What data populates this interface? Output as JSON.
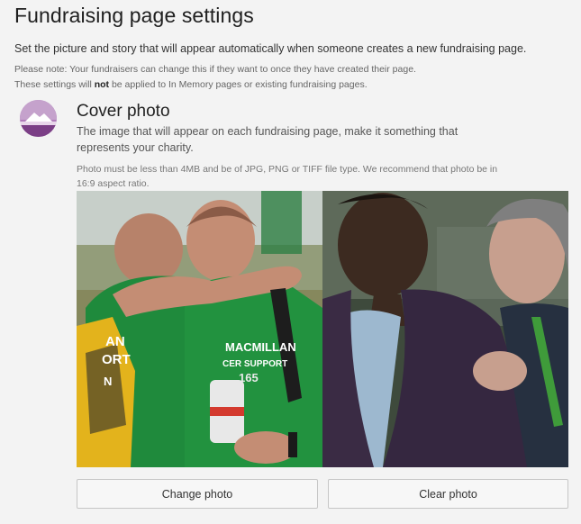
{
  "page": {
    "title": "Fundraising page settings",
    "intro": "Set the picture and story that will appear automatically when someone creates a new fundraising page.",
    "note_line1": "Please note: Your fundraisers can change this if they want to once they have created their page.",
    "note_line2_prefix": "These settings will ",
    "note_line2_bold": "not",
    "note_line2_suffix": " be applied to In Memory pages or existing fundraising pages."
  },
  "cover_photo": {
    "icon": "photo-landscape-icon",
    "title": "Cover photo",
    "description": "The image that will appear on each fundraising page, make it something that represents your charity.",
    "requirements": "Photo must be less than 4MB and be of JPG, PNG or TIFF file type. We recommend that photo be in 16:9 aspect ratio.",
    "image_text": {
      "shirt_left": "AN",
      "shirt_left2": "ORT",
      "shirt_left3": "N",
      "shirt_right": "MACMILLAN",
      "shirt_right2": "CER SUPPORT",
      "bib": "165"
    },
    "buttons": {
      "change": "Change photo",
      "clear": "Clear photo"
    }
  },
  "colors": {
    "icon_purple": "#7b3f86",
    "macmillan_green": "#1f8a3c",
    "background": "#f3f3f3"
  }
}
